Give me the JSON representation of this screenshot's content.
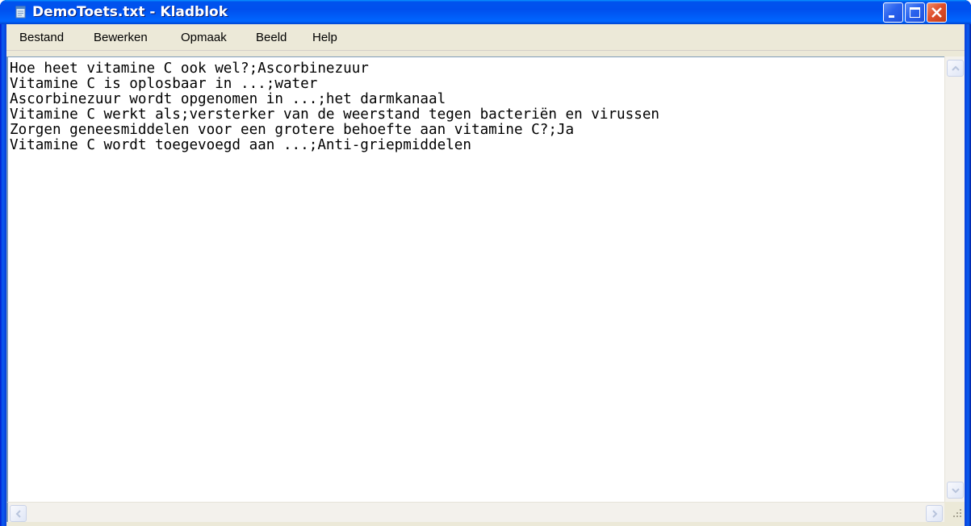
{
  "window": {
    "title": "DemoToets.txt - Kladblok",
    "icon": "notepad-icon"
  },
  "title_buttons": {
    "minimize": "minimize-icon",
    "maximize": "maximize-icon",
    "close": "close-icon"
  },
  "menu": {
    "items": [
      {
        "label": "Bestand"
      },
      {
        "label": "Bewerken"
      },
      {
        "label": "Opmaak"
      },
      {
        "label": "Beeld"
      },
      {
        "label": "Help"
      }
    ]
  },
  "editor": {
    "lines": [
      "Hoe heet vitamine C ook wel?;Ascorbinezuur",
      "Vitamine C is oplosbaar in ...;water",
      "Ascorbinezuur wordt opgenomen in ...;het darmkanaal",
      "Vitamine C werkt als;versterker van de weerstand tegen bacteriën en virussen",
      "Zorgen geneesmiddelen voor een grotere behoefte aan vitamine C?;Ja",
      "Vitamine C wordt toegevoegd aan ...;Anti-griepmiddelen"
    ]
  },
  "colors": {
    "titlebar": "#0055ea",
    "frame": "#0831d9",
    "menubar": "#ece9d8",
    "close_button": "#e0502c"
  }
}
